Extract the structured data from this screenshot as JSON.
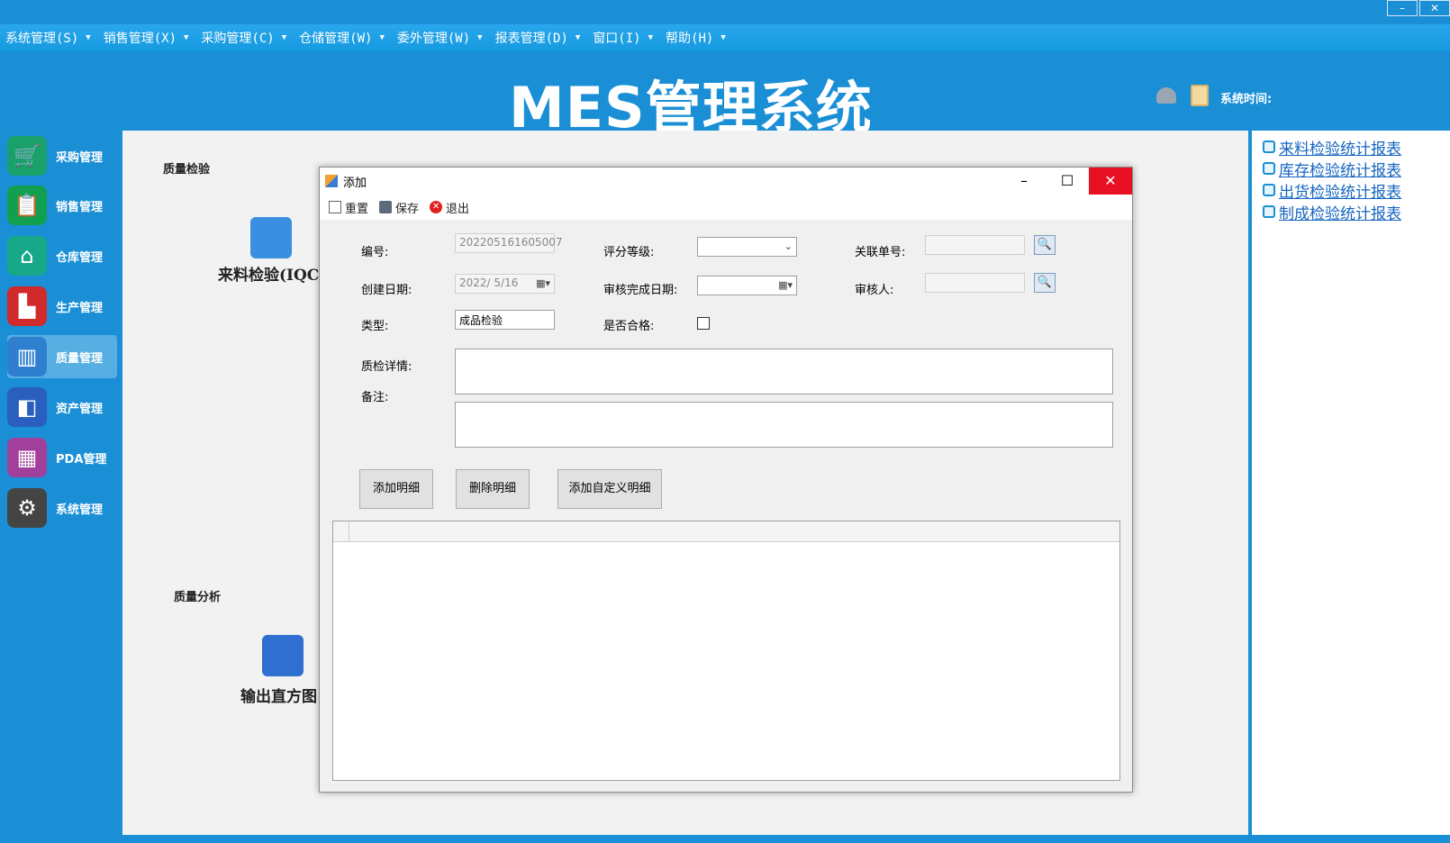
{
  "menu": [
    "系统管理(S)",
    "销售管理(X)",
    "采购管理(C)",
    "仓储管理(W)",
    "委外管理(W)",
    "报表管理(D)",
    "窗口(I)",
    "帮助(H)"
  ],
  "header": {
    "title": "MES管理系统",
    "system_time_label": "系统时间:"
  },
  "window_controls": {
    "minimize": "–",
    "close": "✕"
  },
  "sidebar": [
    {
      "label": "采购管理",
      "icon": "cart-icon",
      "color": "#1aa06b"
    },
    {
      "label": "销售管理",
      "icon": "clipboard-icon",
      "color": "#10a050"
    },
    {
      "label": "仓库管理",
      "icon": "warehouse-icon",
      "color": "#17a88a"
    },
    {
      "label": "生产管理",
      "icon": "factory-icon",
      "color": "#d02a2a"
    },
    {
      "label": "质量管理",
      "icon": "shop-icon",
      "color": "#2f7fd0"
    },
    {
      "label": "资产管理",
      "icon": "presentation-icon",
      "color": "#2a5fc0"
    },
    {
      "label": "PDA管理",
      "icon": "calculator-icon",
      "color": "#a0409a"
    },
    {
      "label": "系统管理",
      "icon": "gear-icon",
      "color": "#444444"
    }
  ],
  "main": {
    "section1_title": "质量检验",
    "tile1_label": "来料检验(IQC",
    "section2_title": "质量分析",
    "tile2_label": "输出直方图"
  },
  "right_links": [
    "来料检验统计报表",
    "库存检验统计报表",
    "出货检验统计报表",
    "制成检验统计报表"
  ],
  "dialog": {
    "title": "添加",
    "toolbar": {
      "reset": "重置",
      "save": "保存",
      "exit": "退出"
    },
    "labels": {
      "number": "编号:",
      "rating": "评分等级:",
      "related_no": "关联单号:",
      "create_date": "创建日期:",
      "review_date": "审核完成日期:",
      "reviewer": "审核人:",
      "type": "类型:",
      "qualified": "是否合格:",
      "detail": "质检详情:",
      "remark": "备注:"
    },
    "values": {
      "number": "202205161605007",
      "create_date": "2022/ 5/16",
      "type": "成品检验"
    },
    "buttons": {
      "add_detail": "添加明细",
      "delete_detail": "删除明细",
      "add_custom_detail": "添加自定义明细"
    }
  }
}
